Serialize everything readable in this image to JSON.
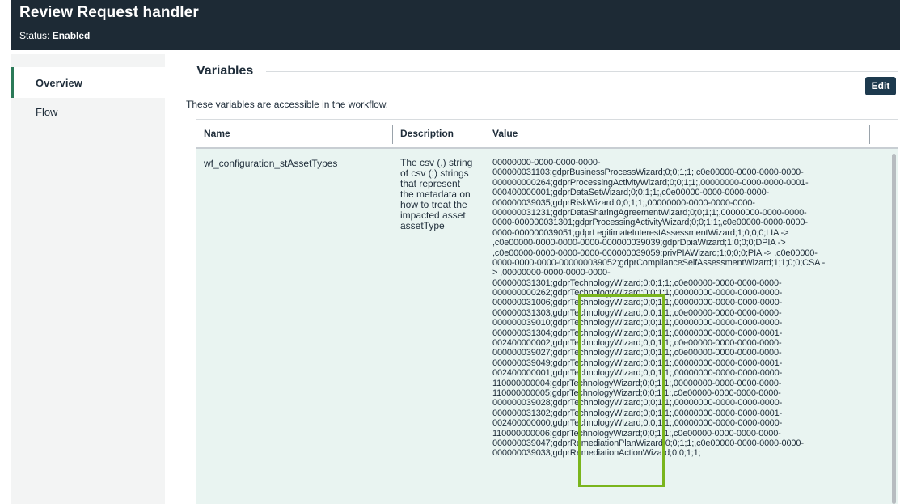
{
  "header": {
    "title": "Review Request handler",
    "status_label": "Status:",
    "status_value": "Enabled"
  },
  "sidebar": {
    "items": [
      {
        "label": "Overview",
        "active": true
      },
      {
        "label": "Flow",
        "active": false
      }
    ]
  },
  "main": {
    "section_title": "Variables",
    "edit_label": "Edit",
    "description": "These variables are accessible in the workflow.",
    "table": {
      "columns": [
        "Name",
        "Description",
        "Value"
      ],
      "row": {
        "name": "wf_configuration_stAssetTypes",
        "description": "The csv (,) string of csv (;) strings that represent the metadata on how to treat the impacted asset assetType",
        "value_lines": [
          "00000000-0000-0000-0000-",
          "000000031103;gdprBusinessProcessWizard;0;0;1;1;,c0e00000-0000-0000-0000-",
          "000000000264;gdprProcessingActivityWizard;0;0;1;1;,00000000-0000-0000-0001-",
          "000400000001;gdprDataSetWizard;0;0;1;1;,c0e00000-0000-0000-0000-",
          "000000039035;gdprRiskWizard;0;0;1;1;,00000000-0000-0000-0000-",
          "000000031231;gdprDataSharingAgreementWizard;0;0;1;1;,00000000-0000-0000-",
          "0000-000000031301;gdprProcessingActivityWizard;0;0;1;1;,c0e00000-0000-0000-",
          "0000-000000039051;gdprLegitimateInterestAssessmentWizard;1;0;0;0;LIA ->",
          ",c0e00000-0000-0000-0000-000000039039;gdprDpiaWizard;1;0;0;0;DPIA ->",
          ",c0e00000-0000-0000-0000-000000039059;privPIAWizard;1;0;0;0;PIA -> ,c0e00000-",
          "0000-0000-0000-000000039052;gdprComplianceSelfAssessmentWizard;1;1;0;0;CSA -",
          "> ,00000000-0000-0000-0000-",
          "000000031301;gdprTechnologyWizard;0;0;1;1;,c0e00000-0000-0000-0000-",
          "000000000262;gdprTechnologyWizard;0;0;1;1;,00000000-0000-0000-0000-",
          "000000031006;gdprTechnologyWizard;0;0;1;1;,00000000-0000-0000-0000-",
          "000000031303;gdprTechnologyWizard;0;0;1;1;,c0e00000-0000-0000-0000-",
          "000000039010;gdprTechnologyWizard;0;0;1;1;,00000000-0000-0000-0000-",
          "000000031304;gdprTechnologyWizard;0;0;1;1;,00000000-0000-0000-0001-",
          "002400000002;gdprTechnologyWizard;0;0;1;1;,c0e00000-0000-0000-0000-",
          "000000039027;gdprTechnologyWizard;0;0;1;1;,c0e00000-0000-0000-0000-",
          "000000039049;gdprTechnologyWizard;0;0;1;1;,00000000-0000-0000-0001-",
          "002400000001;gdprTechnologyWizard;0;0;1;1;,00000000-0000-0000-0000-",
          "110000000004;gdprTechnologyWizard;0;0;1;1;,00000000-0000-0000-0000-",
          "110000000005;gdprTechnologyWizard;0;0;1;1;,c0e00000-0000-0000-0000-",
          "000000039028;gdprTechnologyWizard;0;0;1;1;,00000000-0000-0000-0000-",
          "000000031302;gdprTechnologyWizard;0;0;1;1;,00000000-0000-0000-0001-",
          "002400000000;gdprTechnologyWizard;0;0;1;1;,00000000-0000-0000-0000-",
          "110000000006;gdprTechnologyWizard;0;0;1;1;,c0e00000-0000-0000-0000-",
          "000000039047;gdprRemediationPlanWizard;0;0;1;1;,c0e00000-0000-0000-0000-",
          "000000039033;gdprRemediationActionWizard;0;0;1;1;"
        ]
      }
    }
  },
  "colors": {
    "header_bg": "#1d2a35",
    "active_nav_accent": "#2b7a58",
    "row_bg": "#e9f4f1",
    "edit_button_bg": "#1d3a4e",
    "highlight_border": "#7ab51d"
  }
}
